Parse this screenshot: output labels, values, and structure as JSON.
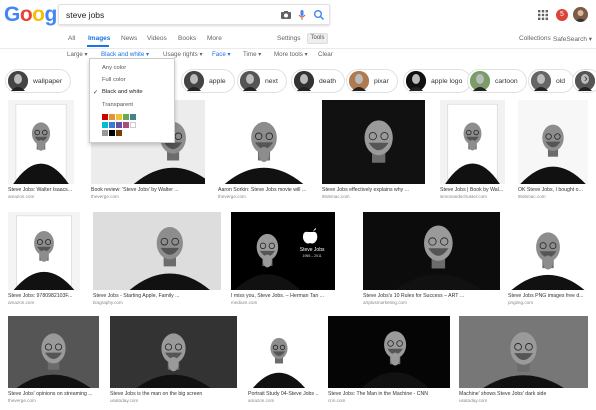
{
  "logo": {
    "letters": [
      "G",
      "o",
      "o",
      "g",
      "l",
      "e"
    ],
    "colors": [
      "#4285f4",
      "#ea4335",
      "#fbbc05",
      "#4285f4",
      "#34a853",
      "#ea4335"
    ]
  },
  "search": {
    "value": "steve jobs"
  },
  "user": {
    "notif_count": "5"
  },
  "tabs": {
    "items": [
      "All",
      "Images",
      "News",
      "Videos",
      "Books",
      "More"
    ],
    "active": "Images",
    "settings": "Settings",
    "tools": "Tools",
    "collections": "Collections",
    "safesearch": "SafeSearch ▾"
  },
  "filters": {
    "items": [
      "Large ▾",
      "Black and white ▾",
      "Usage rights ▾",
      "Face ▾",
      "Time ▾",
      "More tools ▾",
      "Clear"
    ]
  },
  "chips": [
    "wallpaper",
    "",
    "apple",
    "next",
    "death",
    "pixar",
    "apple logo",
    "cartoon",
    "old"
  ],
  "color_menu": {
    "options": [
      "Any color",
      "Full color",
      "Black and white",
      "Transparent"
    ],
    "selected": "Black and white",
    "swatches": [
      "#cc0000",
      "#e69138",
      "#f1c232",
      "#6aa84f",
      "#45818e",
      "#00bcd4",
      "#3c78d8",
      "#674ea7",
      "#a64d79",
      "#ffffff",
      "#999999",
      "#000000",
      "#783f04"
    ]
  },
  "results": [
    {
      "caption": "Steve Jobs: Walter Isaacs...",
      "source": "amazon.com"
    },
    {
      "caption": "Book review: 'Steve Jobs' by Walter ...",
      "source": "theverge.com"
    },
    {
      "caption": "Aaron Sorkin: Steve Jobs movie will ...",
      "source": "theverge.com"
    },
    {
      "caption": "Steve Jobs effectively explains why ...",
      "source": "9to5mac.com"
    },
    {
      "caption": "Steve Jobs | Book by Wal...",
      "source": "simonandschuster.com"
    },
    {
      "caption": "OK Steve Jobs, I bought o...",
      "source": "9to5mac.com"
    },
    {
      "caption": "Steve Jobs: 9780982103F...",
      "source": "amazon.com"
    },
    {
      "caption": "Steve Jobs - Starting Apple, Family ...",
      "source": "biography.com"
    },
    {
      "caption": "I miss you, Steve Jobs. – Herman Tan ...",
      "source": "medium.com"
    },
    {
      "caption": "Steve Jobs's 10 Rules for Success – ART ...",
      "source": "artplusmarketing.com"
    },
    {
      "caption": "Steve Jobs PNG images free d...",
      "source": "pngimg.com"
    },
    {
      "caption": "Steve Jobs' opinions on streaming ...",
      "source": "theverge.com"
    },
    {
      "caption": "Steve Jobs is the man on the big screen",
      "source": "usatoday.com"
    },
    {
      "caption": "Portrait Study 04-Steve Jobs ...",
      "source": "amazon.com"
    },
    {
      "caption": "Steve Jobs: The Man in the Machine - CNN",
      "source": "cnn.com"
    },
    {
      "caption": "Machine' shows Steve Jobs' dark side",
      "source": "usatoday.com"
    }
  ],
  "apple_tile": {
    "title": "Steve Jobs",
    "dates": "1955 – 2011"
  }
}
